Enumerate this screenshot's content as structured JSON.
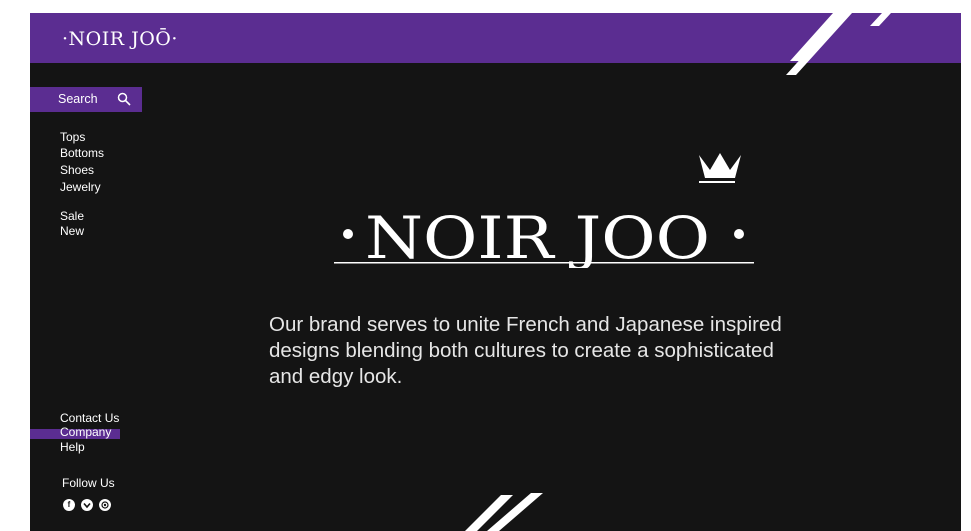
{
  "header": {
    "logo_text": "·NOIR JOŌ·"
  },
  "sidebar": {
    "search_label": "Search",
    "categories": [
      "Tops",
      "Bottoms",
      "Shoes",
      "Jewelry"
    ],
    "specials": [
      "Sale",
      "New"
    ],
    "footer_links": [
      "Contact Us",
      "Company",
      "Help"
    ],
    "follow_label": "Follow Us",
    "social_icons": [
      "facebook-icon",
      "twitter-icon",
      "instagram-icon"
    ]
  },
  "hero": {
    "logo_text": "·NOIR JOŌ·",
    "tagline_lines": [
      "Our brand serves to unite French and Japanese inspired",
      "designs blending both cultures to create a sophisticated",
      "and edgy look."
    ]
  },
  "colors": {
    "accent": "#5b2d91",
    "background": "#141414",
    "text": "#ffffff"
  }
}
